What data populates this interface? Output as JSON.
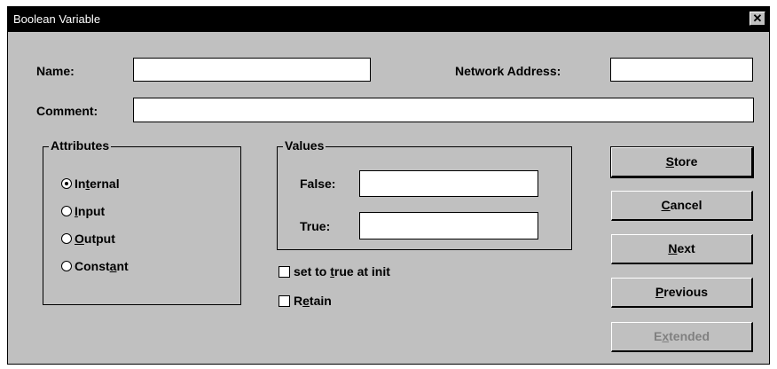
{
  "window": {
    "title": "Boolean Variable",
    "close_label": "✕"
  },
  "fields": {
    "name_label": "Name:",
    "name_value": "",
    "network_address_label": "Network Address:",
    "network_address_value": "",
    "comment_label": "Comment:",
    "comment_value": ""
  },
  "attributes": {
    "title": "Attributes",
    "options": [
      {
        "pre": "In",
        "key": "t",
        "post": "ernal",
        "selected": true
      },
      {
        "pre": "",
        "key": "I",
        "post": "nput",
        "selected": false
      },
      {
        "pre": "",
        "key": "O",
        "post": "utput",
        "selected": false
      },
      {
        "pre": "Const",
        "key": "a",
        "post": "nt",
        "selected": false
      }
    ]
  },
  "values": {
    "title": "Values",
    "false_label": "False:",
    "false_value": "",
    "true_label": "True:",
    "true_value": ""
  },
  "checkboxes": {
    "init": {
      "pre": "set to ",
      "key": "t",
      "post": "rue at init",
      "checked": false
    },
    "retain": {
      "pre": "R",
      "key": "e",
      "post": "tain",
      "checked": false
    }
  },
  "buttons": {
    "store": {
      "key": "S",
      "rest": "tore",
      "enabled": true
    },
    "cancel": {
      "key": "C",
      "rest": "ancel",
      "enabled": true
    },
    "next": {
      "key": "N",
      "rest": "ext",
      "enabled": true
    },
    "previous": {
      "key": "P",
      "rest": "revious",
      "enabled": true
    },
    "extended": {
      "pre": "E",
      "key": "x",
      "rest": "tended",
      "enabled": false
    }
  }
}
